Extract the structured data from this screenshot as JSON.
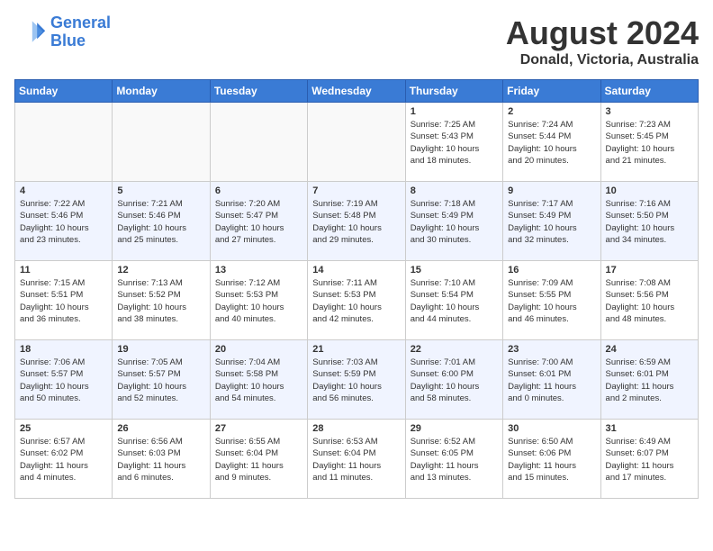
{
  "header": {
    "logo_line1": "General",
    "logo_line2": "Blue",
    "month": "August 2024",
    "location": "Donald, Victoria, Australia"
  },
  "days_of_week": [
    "Sunday",
    "Monday",
    "Tuesday",
    "Wednesday",
    "Thursday",
    "Friday",
    "Saturday"
  ],
  "weeks": [
    [
      {
        "day": "",
        "info": ""
      },
      {
        "day": "",
        "info": ""
      },
      {
        "day": "",
        "info": ""
      },
      {
        "day": "",
        "info": ""
      },
      {
        "day": "1",
        "info": "Sunrise: 7:25 AM\nSunset: 5:43 PM\nDaylight: 10 hours\nand 18 minutes."
      },
      {
        "day": "2",
        "info": "Sunrise: 7:24 AM\nSunset: 5:44 PM\nDaylight: 10 hours\nand 20 minutes."
      },
      {
        "day": "3",
        "info": "Sunrise: 7:23 AM\nSunset: 5:45 PM\nDaylight: 10 hours\nand 21 minutes."
      }
    ],
    [
      {
        "day": "4",
        "info": "Sunrise: 7:22 AM\nSunset: 5:46 PM\nDaylight: 10 hours\nand 23 minutes."
      },
      {
        "day": "5",
        "info": "Sunrise: 7:21 AM\nSunset: 5:46 PM\nDaylight: 10 hours\nand 25 minutes."
      },
      {
        "day": "6",
        "info": "Sunrise: 7:20 AM\nSunset: 5:47 PM\nDaylight: 10 hours\nand 27 minutes."
      },
      {
        "day": "7",
        "info": "Sunrise: 7:19 AM\nSunset: 5:48 PM\nDaylight: 10 hours\nand 29 minutes."
      },
      {
        "day": "8",
        "info": "Sunrise: 7:18 AM\nSunset: 5:49 PM\nDaylight: 10 hours\nand 30 minutes."
      },
      {
        "day": "9",
        "info": "Sunrise: 7:17 AM\nSunset: 5:49 PM\nDaylight: 10 hours\nand 32 minutes."
      },
      {
        "day": "10",
        "info": "Sunrise: 7:16 AM\nSunset: 5:50 PM\nDaylight: 10 hours\nand 34 minutes."
      }
    ],
    [
      {
        "day": "11",
        "info": "Sunrise: 7:15 AM\nSunset: 5:51 PM\nDaylight: 10 hours\nand 36 minutes."
      },
      {
        "day": "12",
        "info": "Sunrise: 7:13 AM\nSunset: 5:52 PM\nDaylight: 10 hours\nand 38 minutes."
      },
      {
        "day": "13",
        "info": "Sunrise: 7:12 AM\nSunset: 5:53 PM\nDaylight: 10 hours\nand 40 minutes."
      },
      {
        "day": "14",
        "info": "Sunrise: 7:11 AM\nSunset: 5:53 PM\nDaylight: 10 hours\nand 42 minutes."
      },
      {
        "day": "15",
        "info": "Sunrise: 7:10 AM\nSunset: 5:54 PM\nDaylight: 10 hours\nand 44 minutes."
      },
      {
        "day": "16",
        "info": "Sunrise: 7:09 AM\nSunset: 5:55 PM\nDaylight: 10 hours\nand 46 minutes."
      },
      {
        "day": "17",
        "info": "Sunrise: 7:08 AM\nSunset: 5:56 PM\nDaylight: 10 hours\nand 48 minutes."
      }
    ],
    [
      {
        "day": "18",
        "info": "Sunrise: 7:06 AM\nSunset: 5:57 PM\nDaylight: 10 hours\nand 50 minutes."
      },
      {
        "day": "19",
        "info": "Sunrise: 7:05 AM\nSunset: 5:57 PM\nDaylight: 10 hours\nand 52 minutes."
      },
      {
        "day": "20",
        "info": "Sunrise: 7:04 AM\nSunset: 5:58 PM\nDaylight: 10 hours\nand 54 minutes."
      },
      {
        "day": "21",
        "info": "Sunrise: 7:03 AM\nSunset: 5:59 PM\nDaylight: 10 hours\nand 56 minutes."
      },
      {
        "day": "22",
        "info": "Sunrise: 7:01 AM\nSunset: 6:00 PM\nDaylight: 10 hours\nand 58 minutes."
      },
      {
        "day": "23",
        "info": "Sunrise: 7:00 AM\nSunset: 6:01 PM\nDaylight: 11 hours\nand 0 minutes."
      },
      {
        "day": "24",
        "info": "Sunrise: 6:59 AM\nSunset: 6:01 PM\nDaylight: 11 hours\nand 2 minutes."
      }
    ],
    [
      {
        "day": "25",
        "info": "Sunrise: 6:57 AM\nSunset: 6:02 PM\nDaylight: 11 hours\nand 4 minutes."
      },
      {
        "day": "26",
        "info": "Sunrise: 6:56 AM\nSunset: 6:03 PM\nDaylight: 11 hours\nand 6 minutes."
      },
      {
        "day": "27",
        "info": "Sunrise: 6:55 AM\nSunset: 6:04 PM\nDaylight: 11 hours\nand 9 minutes."
      },
      {
        "day": "28",
        "info": "Sunrise: 6:53 AM\nSunset: 6:04 PM\nDaylight: 11 hours\nand 11 minutes."
      },
      {
        "day": "29",
        "info": "Sunrise: 6:52 AM\nSunset: 6:05 PM\nDaylight: 11 hours\nand 13 minutes."
      },
      {
        "day": "30",
        "info": "Sunrise: 6:50 AM\nSunset: 6:06 PM\nDaylight: 11 hours\nand 15 minutes."
      },
      {
        "day": "31",
        "info": "Sunrise: 6:49 AM\nSunset: 6:07 PM\nDaylight: 11 hours\nand 17 minutes."
      }
    ]
  ]
}
